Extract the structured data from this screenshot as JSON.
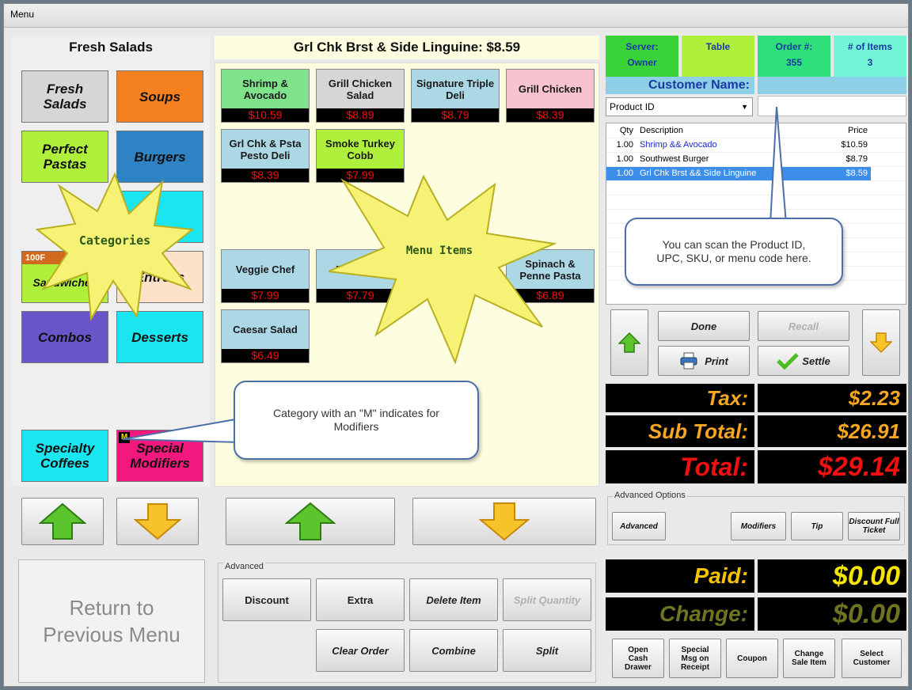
{
  "window": {
    "title": "Menu"
  },
  "category_header": "Fresh Salads",
  "menu_header": "Grl Chk Brst & Side Linguine: $8.59",
  "categories": [
    {
      "label": "Fresh Salads",
      "color": "#d6d6d6"
    },
    {
      "label": "Soups",
      "color": "#f5801f"
    },
    {
      "label": "Perfect Pastas",
      "color": "#aef03c"
    },
    {
      "label": "Burgers",
      "color": "#2e83c4"
    },
    {
      "label": "",
      "color": "#1ae6f0"
    },
    {
      "label": "Sandwiches",
      "color": "#aef03c",
      "tag": "100F"
    },
    {
      "label": "Entrees",
      "color": "#fde1c8"
    },
    {
      "label": "Combos",
      "color": "#6a55c8"
    },
    {
      "label": "Desserts",
      "color": "#1ae6f0"
    },
    {
      "label": "Specialty Coffees",
      "color": "#1ae6f0"
    },
    {
      "label": "Special Modifiers",
      "color": "#f2187d",
      "badge": "M"
    }
  ],
  "menu_items": [
    {
      "name": "Shrimp & Avocado",
      "price": "$10.59",
      "color": "#7ee38a"
    },
    {
      "name": "Grill Chicken Salad",
      "price": "$8.89",
      "color": "#d6d6d6"
    },
    {
      "name": "Signature Triple Deli",
      "price": "$8.79",
      "color": "#acd8e6"
    },
    {
      "name": "Grill Chicken",
      "price": "$8.39",
      "color": "#f7c3cf"
    },
    {
      "name": "Grl Chk & Psta Pesto Deli",
      "price": "$8.39",
      "color": "#acd8e6"
    },
    {
      "name": "Smoke Turkey Cobb",
      "price": "$7.99",
      "color": "#aef03c"
    },
    {
      "name": "Veggie Chef",
      "price": "$7.99",
      "color": "#acd8e6"
    },
    {
      "name": "Fresh Muf",
      "price": "$7.79",
      "color": "#acd8e6"
    },
    {
      "name": "Spinach & Penne Pasta",
      "price": "$6.89",
      "color": "#acd8e6"
    },
    {
      "name": "Caesar Salad",
      "price": "$6.49",
      "color": "#acd8e6"
    }
  ],
  "header": {
    "server_label": "Server:",
    "server_value": "Owner",
    "table_label": "Table",
    "order_label": "Order #:",
    "order_value": "355",
    "items_label": "# of Items",
    "items_value": "3",
    "customer_label": "Customer Name:",
    "lookup_select": "Product ID"
  },
  "order": {
    "columns": {
      "qty": "Qty",
      "desc": "Description",
      "price": "Price"
    },
    "rows": [
      {
        "qty": "1.00",
        "desc": "Shrimp && Avocado",
        "price": "$10.59"
      },
      {
        "qty": "1.00",
        "desc": "Southwest Burger",
        "price": "$8.79"
      },
      {
        "qty": "1.00",
        "desc": "Grl Chk Brst && Side Linguine",
        "price": "$8.59"
      }
    ]
  },
  "actions": {
    "done": "Done",
    "recall": "Recall",
    "print": "Print",
    "settle": "Settle"
  },
  "totals": {
    "tax_label": "Tax:",
    "tax": "$2.23",
    "subtotal_label": "Sub Total:",
    "subtotal": "$26.91",
    "total_label": "Total:",
    "total": "$29.14",
    "paid_label": "Paid:",
    "paid": "$0.00",
    "change_label": "Change:",
    "change": "$0.00"
  },
  "advanced_options": {
    "legend": "Advanced Options",
    "advanced": "Advanced",
    "modifiers": "Modifiers",
    "tip": "Tip",
    "discount_full": "Discount Full Ticket"
  },
  "advanced": {
    "legend": "Advanced",
    "discount": "Discount",
    "extra": "Extra",
    "delete_item": "Delete Item",
    "split_quantity": "Split Quantity",
    "clear_order": "Clear Order",
    "combine": "Combine",
    "split": "Split"
  },
  "return_label": "Return to Previous Menu",
  "bottom_buttons": {
    "open_drawer": "Open Cash Drawer",
    "special_msg": "Special Msg on Receipt",
    "coupon": "Coupon",
    "change_sale": "Change Sale Item",
    "select_customer": "Select Customer"
  },
  "annotations": {
    "categories": "Categories",
    "menu_items": "Menu Items",
    "scan_note": "You can scan the Product ID, UPC, SKU, or menu code here.",
    "modifier_note": "Category with an \"M\" indicates for Modifiers"
  }
}
